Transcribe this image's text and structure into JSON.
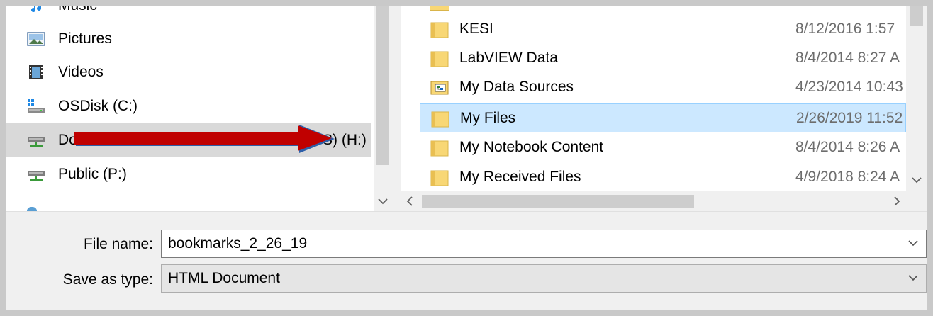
{
  "navigation": {
    "items": [
      {
        "label": "Music",
        "icon": "music-icon"
      },
      {
        "label": "Pictures",
        "icon": "pictures-icon"
      },
      {
        "label": "Videos",
        "icon": "videos-icon"
      },
      {
        "label": "OSDisk (C:)",
        "icon": "os-drive-icon"
      },
      {
        "label": "Do",
        "label_suffix": "S) (H:)",
        "icon": "network-drive-icon",
        "selected": true
      },
      {
        "label": "Public (P:)",
        "icon": "network-drive-icon"
      }
    ]
  },
  "file_list": {
    "rows": [
      {
        "name": "KESI",
        "date": "8/12/2016 1:57",
        "icon": "folder-icon"
      },
      {
        "name": "LabVIEW Data",
        "date": "8/4/2014 8:27 A",
        "icon": "folder-icon"
      },
      {
        "name": "My Data Sources",
        "date": "4/23/2014 10:43",
        "icon": "data-sources-folder-icon"
      },
      {
        "name": "My Files",
        "date": "2/26/2019 11:52",
        "icon": "folder-icon",
        "selected": true
      },
      {
        "name": "My Notebook Content",
        "date": "8/4/2014 8:26 A",
        "icon": "folder-icon"
      },
      {
        "name": "My Received Files",
        "date": "4/9/2018 8:24 A",
        "icon": "folder-icon"
      }
    ]
  },
  "form": {
    "file_name_label": "File name:",
    "file_name_value": "bookmarks_2_26_19",
    "save_as_type_label": "Save as type:",
    "save_as_type_value": "HTML Document"
  },
  "colors": {
    "selected_row": "#cce8ff",
    "selected_nav": "#d9d9d9",
    "annotation_arrow": "#c00000",
    "folder": "#f8d775"
  }
}
